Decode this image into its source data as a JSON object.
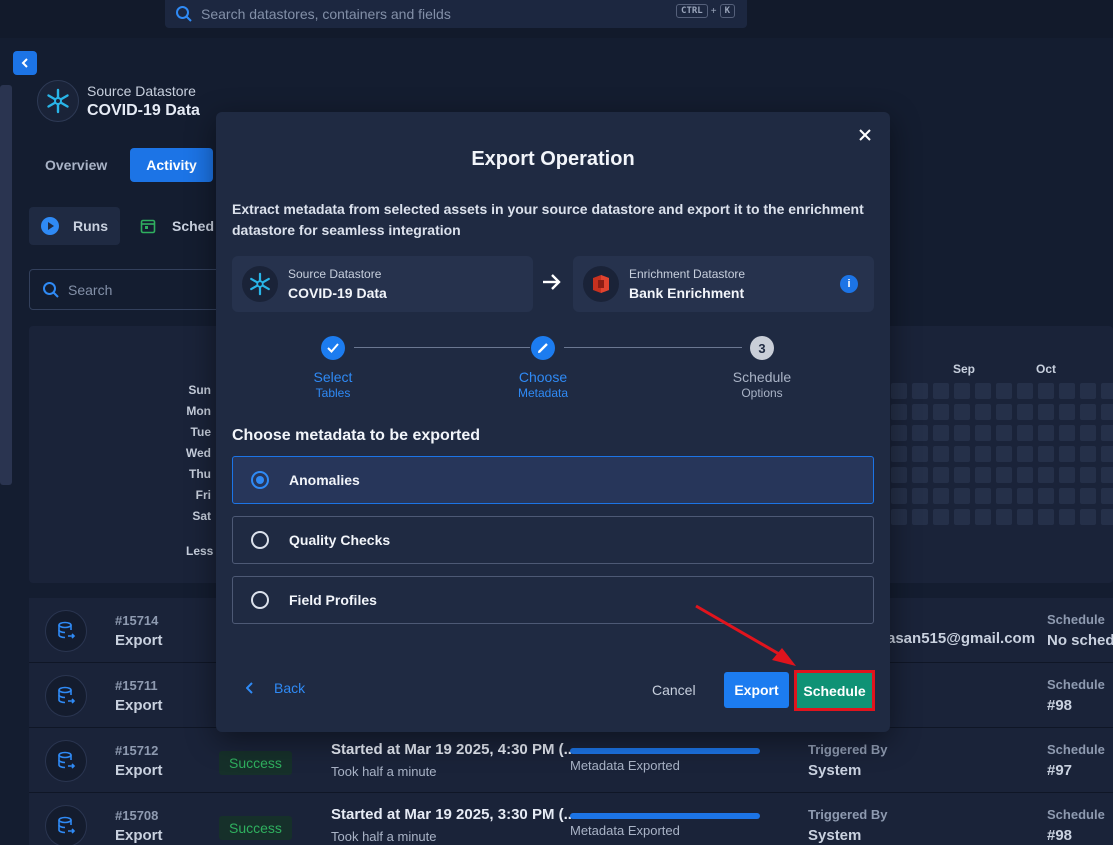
{
  "topbar": {
    "search_placeholder": "Search datastores, containers and fields",
    "kbd_ctrl": "CTRL",
    "kbd_plus": "+",
    "kbd_k": "K"
  },
  "datastore": {
    "label": "Source Datastore",
    "name": "COVID-19 Data"
  },
  "tabs": {
    "overview": "Overview",
    "activity": "Activity"
  },
  "subtabs": {
    "runs": "Runs",
    "schedules": "Sched"
  },
  "search": {
    "placeholder": "Search"
  },
  "heatmap": {
    "days": [
      "Sun",
      "Mon",
      "Tue",
      "Wed",
      "Thu",
      "Fri",
      "Sat"
    ],
    "months": [
      "Sep",
      "Oct"
    ],
    "less": "Less"
  },
  "rows": [
    {
      "id": "#15714",
      "type": "Export",
      "status": "",
      "started": "",
      "took": "",
      "progress": "",
      "trigger_label": "",
      "trigger": "",
      "email": "asan515@gmail.com",
      "schedule_label": "Schedule",
      "schedule": "No schedu"
    },
    {
      "id": "#15711",
      "type": "Export",
      "status": "",
      "started": "",
      "took": "",
      "progress": "",
      "trigger_label": "",
      "trigger": "",
      "email": "",
      "schedule_label": "Schedule",
      "schedule": "#98"
    },
    {
      "id": "#15712",
      "type": "Export",
      "status": "Success",
      "started": "Started at Mar 19 2025, 4:30 PM (...",
      "took": "Took half a minute",
      "progress": "Metadata Exported",
      "trigger_label": "Triggered By",
      "trigger": "System",
      "email": "",
      "schedule_label": "Schedule",
      "schedule": "#97"
    },
    {
      "id": "#15708",
      "type": "Export",
      "status": "Success",
      "started": "Started at Mar 19 2025, 3:30 PM (...",
      "took": "Took half a minute",
      "progress": "Metadata Exported",
      "trigger_label": "Triggered By",
      "trigger": "System",
      "email": "",
      "schedule_label": "Schedule",
      "schedule": "#98"
    }
  ],
  "modal": {
    "title": "Export Operation",
    "description": "Extract metadata from selected assets in your source datastore and export it to the enrichment datastore for seamless integration",
    "source": {
      "label": "Source Datastore",
      "name": "COVID-19 Data"
    },
    "enrichment": {
      "label": "Enrichment Datastore",
      "name": "Bank Enrichment"
    },
    "steps": [
      {
        "title": "Select",
        "sub": "Tables",
        "state": "done"
      },
      {
        "title": "Choose",
        "sub": "Metadata",
        "state": "current"
      },
      {
        "title": "Schedule",
        "sub": "Options",
        "state": "pending",
        "number": "3"
      }
    ],
    "choose_label": "Choose metadata to be exported",
    "options": [
      {
        "label": "Anomalies",
        "selected": true
      },
      {
        "label": "Quality Checks",
        "selected": false
      },
      {
        "label": "Field Profiles",
        "selected": false
      }
    ],
    "back": "Back",
    "cancel": "Cancel",
    "export": "Export",
    "schedule": "Schedule"
  },
  "colors": {
    "accent": "#1c74e6",
    "schedule_button": "#0f9275",
    "highlight": "#e0141d",
    "success": "#2fb05f"
  }
}
